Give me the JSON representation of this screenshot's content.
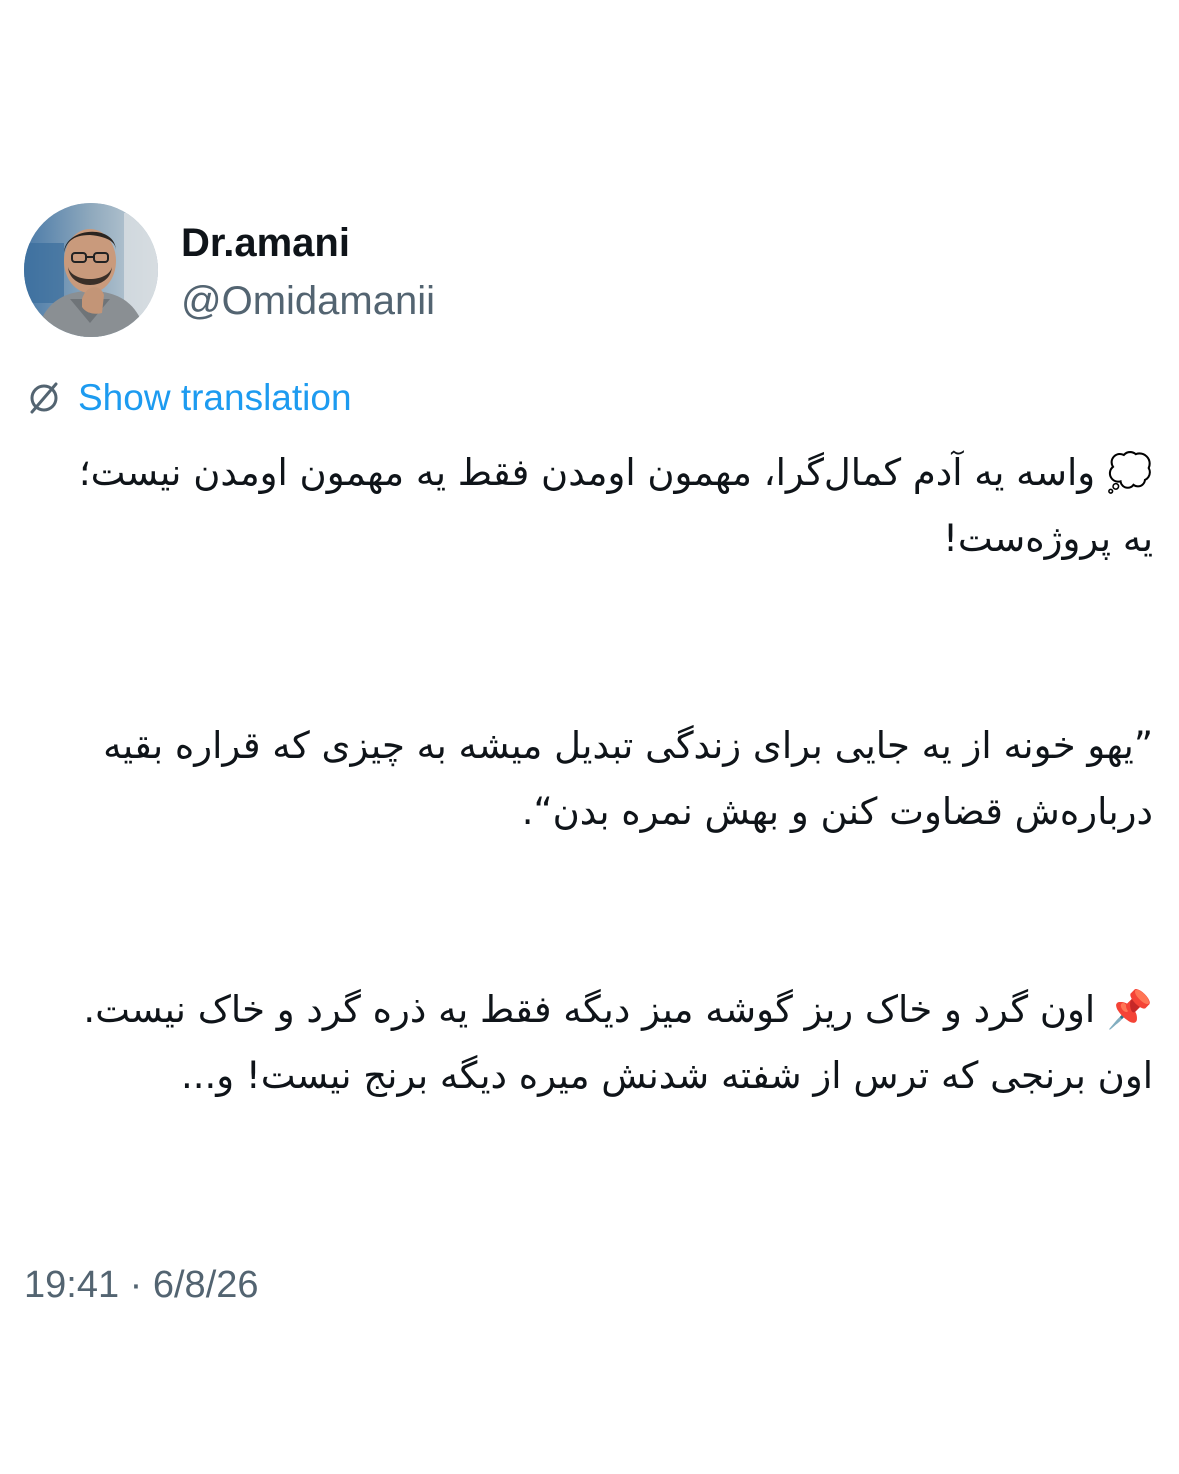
{
  "author": {
    "display_name": "Dr.amani",
    "handle": "@Omidamanii",
    "avatar_icon": "profile-photo"
  },
  "translate": {
    "label": "Show translation",
    "icon": "translate-slash-icon",
    "color": "#1d9bf0"
  },
  "tweet": {
    "paragraphs": [
      "💭 واسه یه آدم کمال‌گرا، مهمون اومدن فقط یه مهمون اومدن نیست؛ یه پروژه‌ست!",
      "”یهو خونه از یه جایی برای زندگی تبدیل میشه به چیزی که قراره بقیه درباره‌ش قضاوت کنن و بهش نمره بدن“.",
      "📌 اون گرد و خاک ریز گوشه میز دیگه فقط یه ذره گرد و خاک نیست. اون برنجی که ترس از شفته شدنش میره دیگه برنج نیست! و..."
    ],
    "timestamp": "19:41 · 6/8/26"
  },
  "colors": {
    "text_primary": "#0f1419",
    "text_secondary": "#536471",
    "accent": "#1d9bf0",
    "background": "#ffffff"
  }
}
